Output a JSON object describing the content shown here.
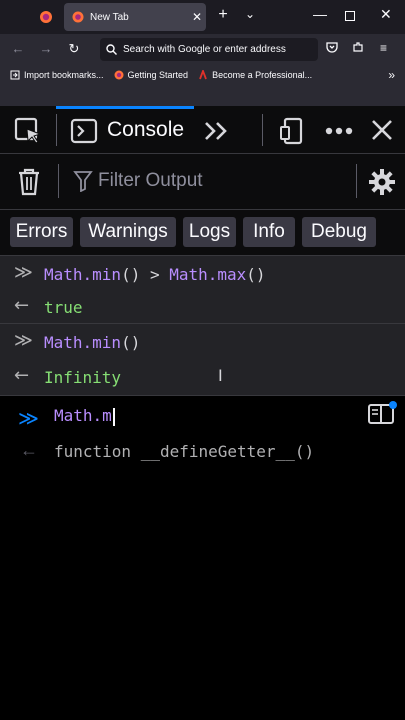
{
  "browser": {
    "tab": {
      "title": "New Tab"
    },
    "urlbar": {
      "placeholder": "Search with Google or enter address"
    },
    "bookmarks": [
      {
        "label": "Import bookmarks...",
        "icon": "import-icon"
      },
      {
        "label": "Getting Started",
        "icon": "firefox-icon"
      },
      {
        "label": "Become a Professional...",
        "icon": "bookmark-icon"
      }
    ]
  },
  "devtools": {
    "active_tool": "Console",
    "filter": {
      "placeholder": "Filter Output"
    },
    "log_levels": [
      "Errors",
      "Warnings",
      "Logs",
      "Info",
      "Debug"
    ],
    "messages": [
      {
        "input": {
          "obj1": "Math",
          "prop1": ".min",
          "call1": "()",
          "op": " > ",
          "obj2": "Math",
          "prop2": ".max",
          "call2": "()"
        },
        "result": "true"
      },
      {
        "input": {
          "obj1": "Math",
          "prop1": ".min",
          "call1": "()"
        },
        "result": "Infinity"
      }
    ],
    "current_input": "Math.m",
    "autocomplete": "function __defineGetter__()"
  },
  "colors": {
    "accent": "#0a84ff",
    "syntax_obj": "#b98eff",
    "result_green": "#86de74"
  }
}
